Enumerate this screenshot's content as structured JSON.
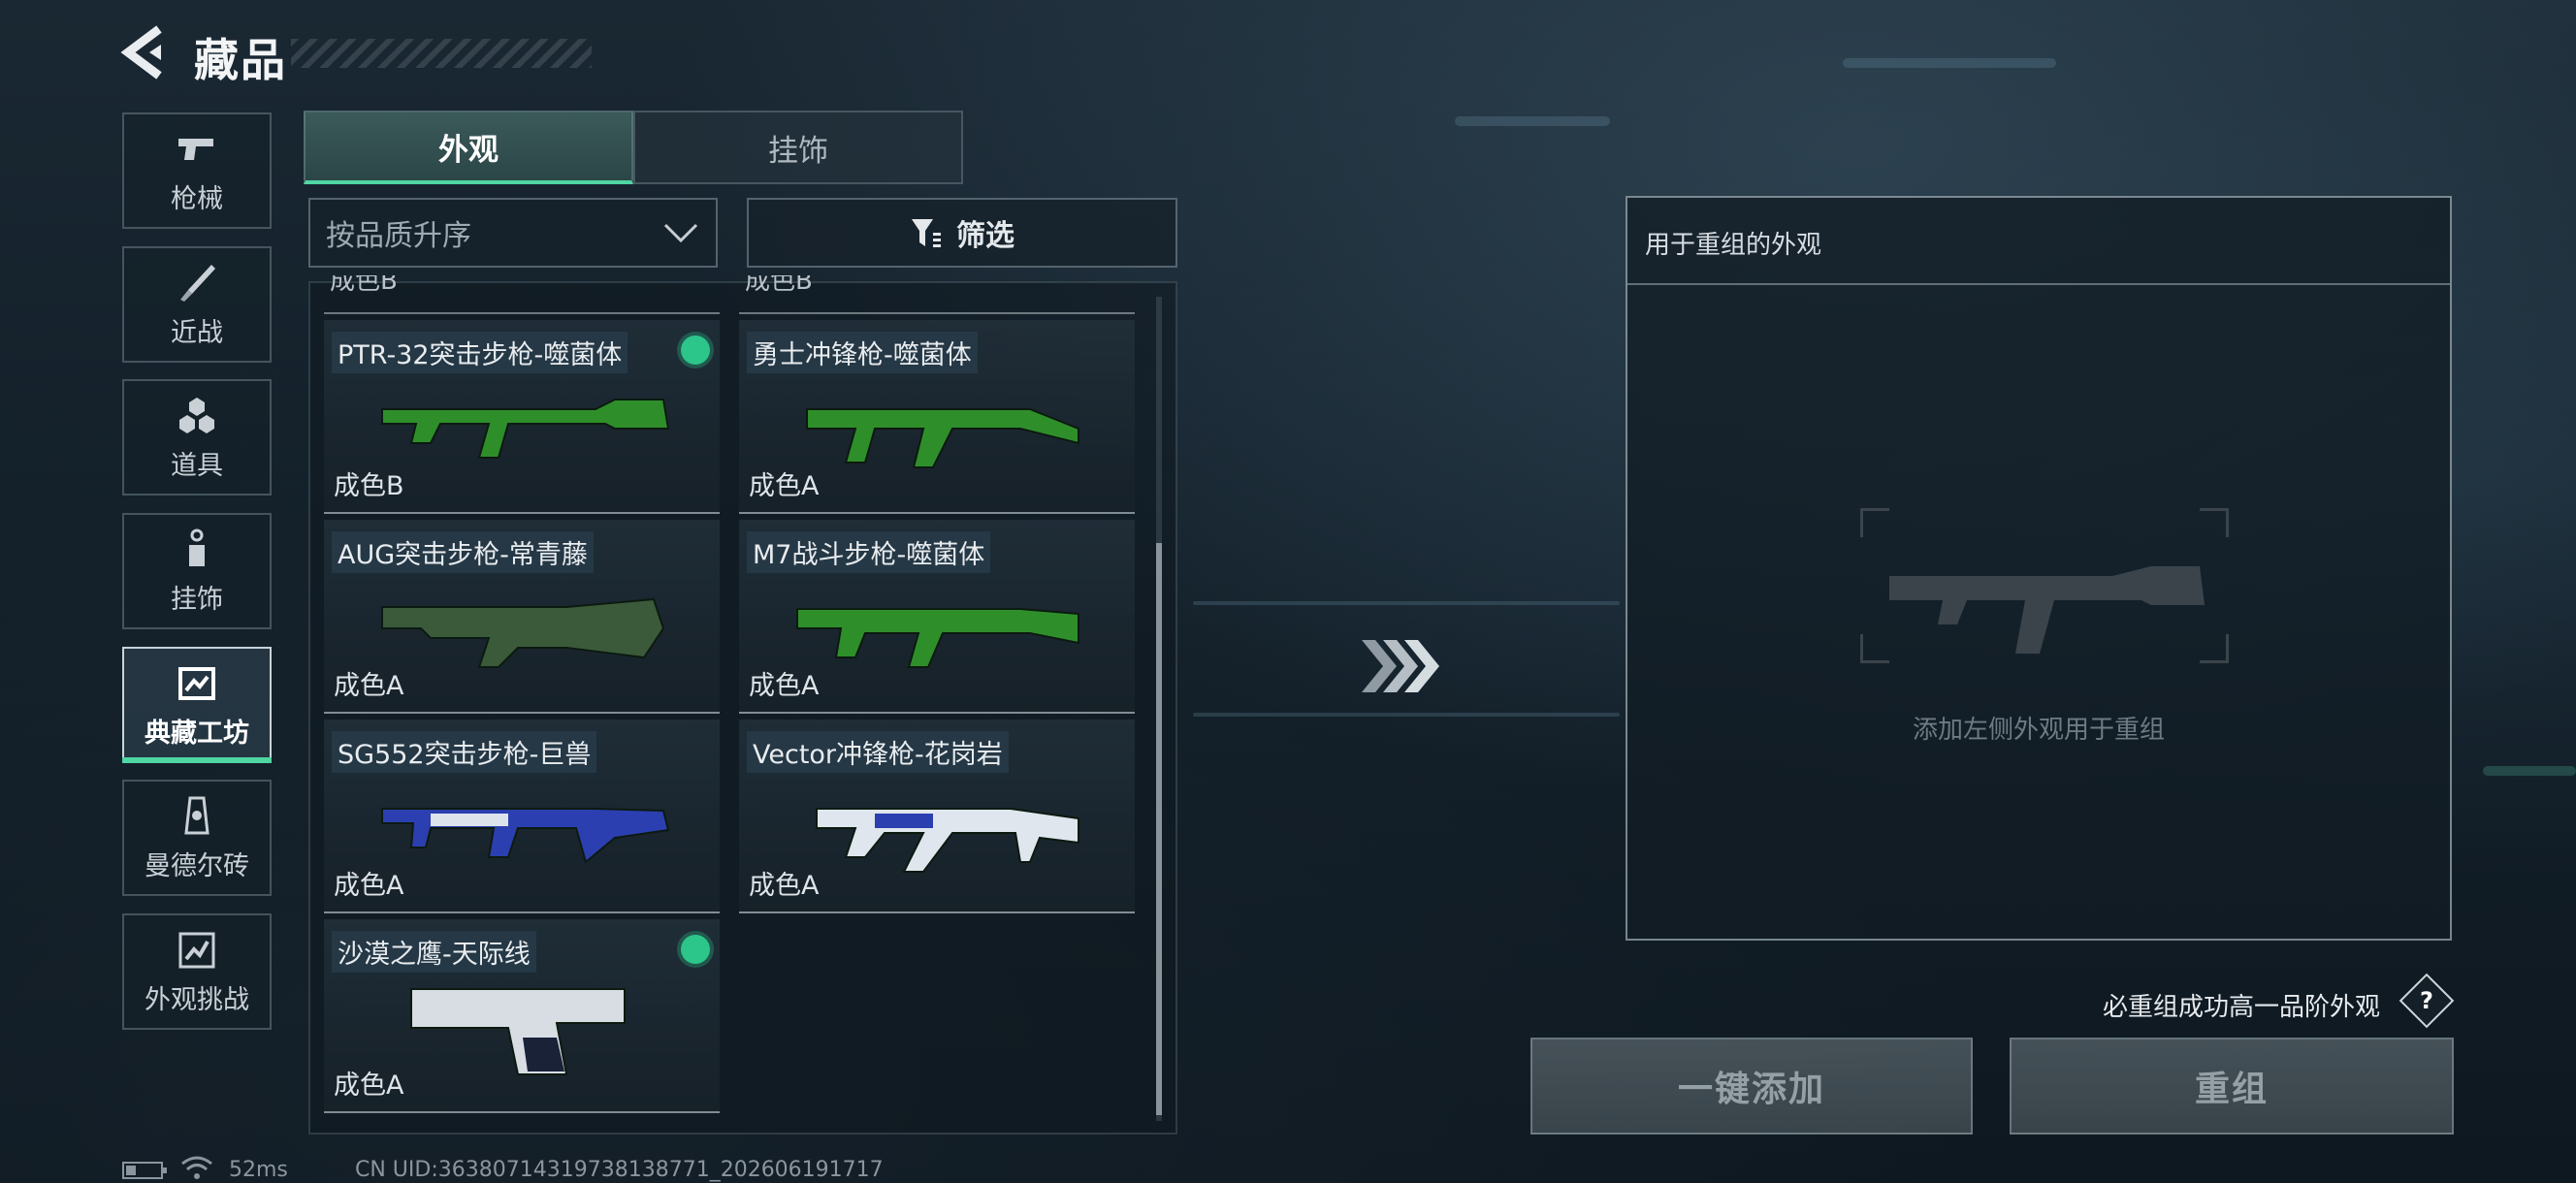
{
  "header": {
    "title": "藏品"
  },
  "nav": [
    {
      "label": "枪械",
      "icon": "pistol-icon"
    },
    {
      "label": "近战",
      "icon": "knife-icon"
    },
    {
      "label": "道具",
      "icon": "grenade-cluster-icon"
    },
    {
      "label": "挂饰",
      "icon": "charm-icon"
    },
    {
      "label": "典藏工坊",
      "icon": "workshop-icon",
      "active": true
    },
    {
      "label": "曼德尔砖",
      "icon": "mandel-brick-icon"
    },
    {
      "label": "外观挑战",
      "icon": "challenge-icon"
    }
  ],
  "tabs": {
    "appearance": "外观",
    "charms": "挂饰"
  },
  "sort": {
    "label": "按品质升序"
  },
  "filter": {
    "label": "筛选"
  },
  "list": {
    "cut_grades": [
      "成色B",
      "成色B"
    ],
    "items": [
      {
        "name": "PTR-32突击步枪-噬菌体",
        "grade": "成色B",
        "selected": true,
        "color": "#2e8f2a"
      },
      {
        "name": "勇士冲锋枪-噬菌体",
        "grade": "成色A",
        "selected": false,
        "color": "#2e8f2a"
      },
      {
        "name": "AUG突击步枪-常青藤",
        "grade": "成色A",
        "selected": false,
        "color": "#3a5a3a"
      },
      {
        "name": "M7战斗步枪-噬菌体",
        "grade": "成色A",
        "selected": false,
        "color": "#2e8f2a"
      },
      {
        "name": "SG552突击步枪-巨兽",
        "grade": "成色A",
        "selected": false,
        "color": "#2b3fb0"
      },
      {
        "name": "Vector冲锋枪-花岗岩",
        "grade": "成色A",
        "selected": false,
        "color": "#dfe6ee"
      },
      {
        "name": "沙漠之鹰-天际线",
        "grade": "成色A",
        "selected": true,
        "color": "#d8dde4"
      }
    ]
  },
  "recombine": {
    "panel_title": "用于重组的外观",
    "placeholder": "添加左侧外观用于重组",
    "hint": "必重组成功高一品阶外观",
    "help": "?",
    "add_all_button": "一键添加",
    "recombine_button": "重组"
  },
  "status": {
    "ping": "52ms",
    "uid": "CN UID:3638071431973813877​1_202606191717"
  },
  "colors": {
    "accent": "#4fd6a2",
    "selected_dot": "#2cc58a"
  }
}
